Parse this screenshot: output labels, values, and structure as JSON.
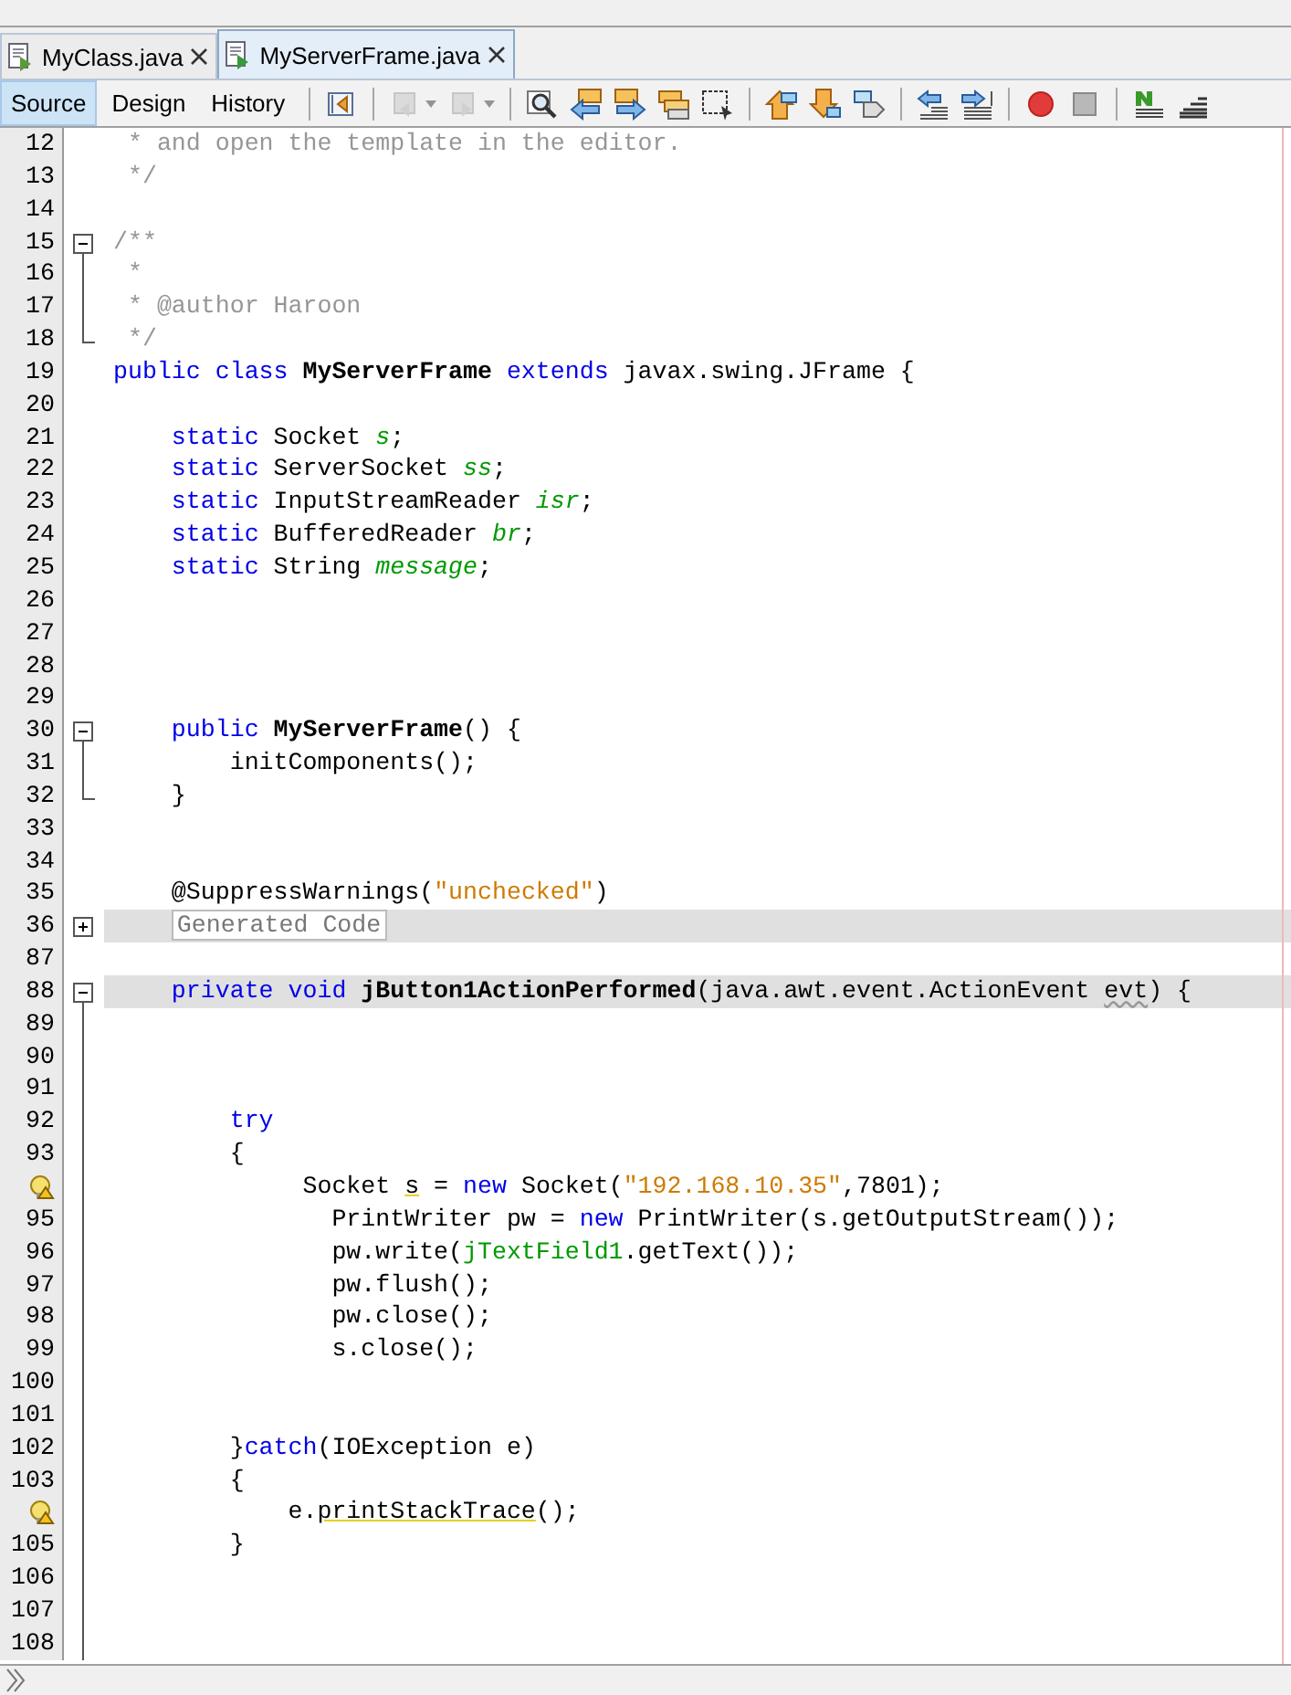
{
  "tabs": [
    {
      "label": "MyClass.java",
      "selected": false
    },
    {
      "label": "MyServerFrame.java",
      "selected": true
    }
  ],
  "view_buttons": [
    {
      "label": "Source",
      "selected": true
    },
    {
      "label": "Design",
      "selected": false
    },
    {
      "label": "History",
      "selected": false
    }
  ],
  "toolbar": [
    {
      "kind": "last-edit",
      "disabled": false
    },
    {
      "kind": "sep"
    },
    {
      "kind": "back",
      "disabled": true
    },
    {
      "kind": "forward",
      "disabled": true
    },
    {
      "kind": "sep"
    },
    {
      "kind": "find",
      "disabled": false
    },
    {
      "kind": "find-prev",
      "disabled": false
    },
    {
      "kind": "find-next",
      "disabled": false
    },
    {
      "kind": "highlight",
      "disabled": false
    },
    {
      "kind": "rect-select",
      "disabled": false
    },
    {
      "kind": "sep"
    },
    {
      "kind": "bookmark-prev",
      "disabled": false
    },
    {
      "kind": "bookmark-next",
      "disabled": false
    },
    {
      "kind": "bookmark-toggle",
      "disabled": false
    },
    {
      "kind": "sep"
    },
    {
      "kind": "shift-left",
      "disabled": false
    },
    {
      "kind": "shift-right",
      "disabled": false
    },
    {
      "kind": "sep"
    },
    {
      "kind": "record",
      "disabled": false
    },
    {
      "kind": "stop",
      "disabled": false
    },
    {
      "kind": "sep"
    },
    {
      "kind": "comment",
      "disabled": false
    },
    {
      "kind": "uncomment",
      "disabled": false
    }
  ],
  "lines": [
    {
      "number": "12",
      "code": [
        {
          "kind": "comment",
          "text": " * and open the template in the editor."
        }
      ]
    },
    {
      "number": "13",
      "code": [
        {
          "kind": "comment",
          "text": " */"
        }
      ]
    },
    {
      "number": "14"
    },
    {
      "number": "15",
      "fold_start": true,
      "expanded": true,
      "code": [
        {
          "kind": "comment",
          "text": "/**"
        }
      ]
    },
    {
      "number": "16",
      "fold_guide": true,
      "code": [
        {
          "kind": "comment",
          "text": " *"
        }
      ]
    },
    {
      "number": "17",
      "fold_guide": true,
      "code": [
        {
          "kind": "comment",
          "text": " * @author Haroon"
        }
      ]
    },
    {
      "number": "18",
      "fold_end": true,
      "code": [
        {
          "kind": "comment",
          "text": " */"
        }
      ]
    },
    {
      "number": "19",
      "code": [
        {
          "kind": "keyword",
          "text": "public class "
        },
        {
          "kind": "declaration",
          "text": "MyServerFrame"
        },
        {
          "kind": "keyword",
          "text": " extends"
        },
        {
          "kind": "plain",
          "text": " javax.swing.JFrame {"
        }
      ]
    },
    {
      "number": "20"
    },
    {
      "number": "21",
      "code": [
        {
          "kind": "keyword",
          "text": "    static"
        },
        {
          "kind": "plain",
          "text": " Socket "
        },
        {
          "kind": "field",
          "text": "s"
        },
        {
          "kind": "plain",
          "text": ";"
        }
      ]
    },
    {
      "number": "22",
      "code": [
        {
          "kind": "keyword",
          "text": "    static"
        },
        {
          "kind": "plain",
          "text": " ServerSocket "
        },
        {
          "kind": "field",
          "text": "ss"
        },
        {
          "kind": "plain",
          "text": ";"
        }
      ]
    },
    {
      "number": "23",
      "code": [
        {
          "kind": "keyword",
          "text": "    static"
        },
        {
          "kind": "plain",
          "text": " InputStreamReader "
        },
        {
          "kind": "field",
          "text": "isr"
        },
        {
          "kind": "plain",
          "text": ";"
        }
      ]
    },
    {
      "number": "24",
      "code": [
        {
          "kind": "keyword",
          "text": "    static"
        },
        {
          "kind": "plain",
          "text": " BufferedReader "
        },
        {
          "kind": "field",
          "text": "br"
        },
        {
          "kind": "plain",
          "text": ";"
        }
      ]
    },
    {
      "number": "25",
      "code": [
        {
          "kind": "keyword",
          "text": "    static"
        },
        {
          "kind": "plain",
          "text": " String "
        },
        {
          "kind": "field",
          "text": "message"
        },
        {
          "kind": "plain",
          "text": ";"
        }
      ]
    },
    {
      "number": "26"
    },
    {
      "number": "27"
    },
    {
      "number": "28"
    },
    {
      "number": "29"
    },
    {
      "number": "30",
      "fold_start": true,
      "expanded": true,
      "code": [
        {
          "kind": "keyword",
          "text": "    public "
        },
        {
          "kind": "declaration",
          "text": "MyServerFrame"
        },
        {
          "kind": "plain",
          "text": "() {"
        }
      ]
    },
    {
      "number": "31",
      "fold_guide": true,
      "code": [
        {
          "kind": "plain",
          "text": "        initComponents();"
        }
      ]
    },
    {
      "number": "32",
      "fold_end": true,
      "code": [
        {
          "kind": "plain",
          "text": "    }"
        }
      ]
    },
    {
      "number": "33"
    },
    {
      "number": "34"
    },
    {
      "number": "35",
      "code": [
        {
          "kind": "plain",
          "text": "    @SuppressWarnings("
        },
        {
          "kind": "string",
          "text": "\"unchecked\""
        },
        {
          "kind": "plain",
          "text": ")"
        }
      ]
    },
    {
      "number": "36",
      "fold_start": true,
      "expanded": false,
      "highlighted": true,
      "code": [
        {
          "kind": "folded",
          "text": "Generated Code"
        }
      ]
    },
    {
      "number": "87"
    },
    {
      "number": "88",
      "fold_start": true,
      "expanded": true,
      "highlighted": true,
      "code": [
        {
          "kind": "keyword",
          "text": "    private void "
        },
        {
          "kind": "declaration",
          "text": "jButton1ActionPerformed"
        },
        {
          "kind": "plain",
          "text": "(java.awt.event.ActionEvent "
        },
        {
          "kind": "unused",
          "text": "evt"
        },
        {
          "kind": "plain",
          "text": ") {"
        }
      ]
    },
    {
      "number": "89",
      "fold_guide": true
    },
    {
      "number": "90",
      "fold_guide": true
    },
    {
      "number": "91",
      "fold_guide": true
    },
    {
      "number": "92",
      "fold_guide": true,
      "code": [
        {
          "kind": "keyword",
          "text": "        try"
        }
      ]
    },
    {
      "number": "93",
      "fold_guide": true,
      "code": [
        {
          "kind": "plain",
          "text": "        {"
        }
      ]
    },
    {
      "warning": true,
      "fold_guide": true,
      "code": [
        {
          "kind": "plain",
          "text": "             Socket "
        },
        {
          "kind": "hint",
          "text": "s"
        },
        {
          "kind": "plain",
          "text": " = "
        },
        {
          "kind": "keyword",
          "text": "new"
        },
        {
          "kind": "plain",
          "text": " Socket("
        },
        {
          "kind": "string",
          "text": "\"192.168.10.35\""
        },
        {
          "kind": "plain",
          "text": ",7801);"
        }
      ]
    },
    {
      "number": "95",
      "fold_guide": true,
      "code": [
        {
          "kind": "plain",
          "text": "               PrintWriter pw = "
        },
        {
          "kind": "keyword",
          "text": "new"
        },
        {
          "kind": "plain",
          "text": " PrintWriter(s.getOutputStream());"
        }
      ]
    },
    {
      "number": "96",
      "fold_guide": true,
      "code": [
        {
          "kind": "plain",
          "text": "               pw.write("
        },
        {
          "kind": "member",
          "text": "jTextField1"
        },
        {
          "kind": "plain",
          "text": ".getText());"
        }
      ]
    },
    {
      "number": "97",
      "fold_guide": true,
      "code": [
        {
          "kind": "plain",
          "text": "               pw.flush();"
        }
      ]
    },
    {
      "number": "98",
      "fold_guide": true,
      "code": [
        {
          "kind": "plain",
          "text": "               pw.close();"
        }
      ]
    },
    {
      "number": "99",
      "fold_guide": true,
      "code": [
        {
          "kind": "plain",
          "text": "               s.close();"
        }
      ]
    },
    {
      "number": "100",
      "fold_guide": true
    },
    {
      "number": "101",
      "fold_guide": true
    },
    {
      "number": "102",
      "fold_guide": true,
      "code": [
        {
          "kind": "plain",
          "text": "        }"
        },
        {
          "kind": "keyword",
          "text": "catch"
        },
        {
          "kind": "plain",
          "text": "(IOException e)"
        }
      ]
    },
    {
      "number": "103",
      "fold_guide": true,
      "code": [
        {
          "kind": "plain",
          "text": "        {"
        }
      ]
    },
    {
      "warning": true,
      "fold_guide": true,
      "code": [
        {
          "kind": "plain",
          "text": "            e."
        },
        {
          "kind": "hint",
          "text": "printStackTrace"
        },
        {
          "kind": "plain",
          "text": "();"
        }
      ]
    },
    {
      "number": "105",
      "fold_guide": true,
      "code": [
        {
          "kind": "plain",
          "text": "        }"
        }
      ]
    },
    {
      "number": "106",
      "fold_guide": true
    },
    {
      "number": "107",
      "fold_guide": true
    },
    {
      "number": "108",
      "fold_guide": true
    }
  ]
}
